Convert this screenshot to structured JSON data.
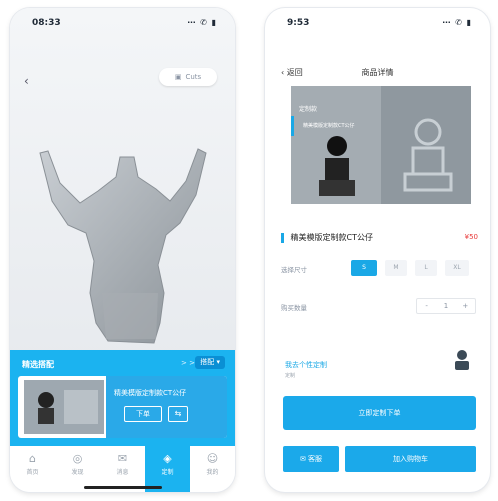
{
  "left": {
    "status": {
      "time": "08:33",
      "icons": "⋯ ✆ ▮"
    },
    "back_label": "‹",
    "size_label": "Cuts",
    "panel": {
      "title": "精选搭配",
      "extra": "> >",
      "tag": "搭配 ▾",
      "product_name": "精美模版定制款CT公仔",
      "button": "下单",
      "share": "⇆"
    },
    "tabs": [
      {
        "label": "首页",
        "icon": "⌂"
      },
      {
        "label": "发现",
        "icon": "◎"
      },
      {
        "label": "消息",
        "icon": "✉"
      },
      {
        "label": "定制",
        "icon": "◈"
      },
      {
        "label": "我的",
        "icon": "☺"
      }
    ]
  },
  "right": {
    "status": {
      "time": "9:53",
      "icons": "⋯ ✆ ▮"
    },
    "nav": {
      "back": "‹ 返回",
      "title": "商品详情"
    },
    "hero": {
      "label": "定制款",
      "sub": "精美模版定制款CT公仔"
    },
    "product": {
      "title": "精美模版定制款CT公仔",
      "price": "¥50"
    },
    "spec_label": "选择尺寸",
    "options": [
      "S",
      "M",
      "L",
      "XL"
    ],
    "qty_label": "购买数量",
    "qty": {
      "minus": "-",
      "value": "1",
      "plus": "+"
    },
    "link": {
      "text": "我去个性定制",
      "sub": "定制"
    },
    "primary": "立即定制下单",
    "chat": "客服",
    "buy": "加入购物车",
    "colors": {
      "accent": "#1aa8e6",
      "price": "#e83838"
    }
  }
}
